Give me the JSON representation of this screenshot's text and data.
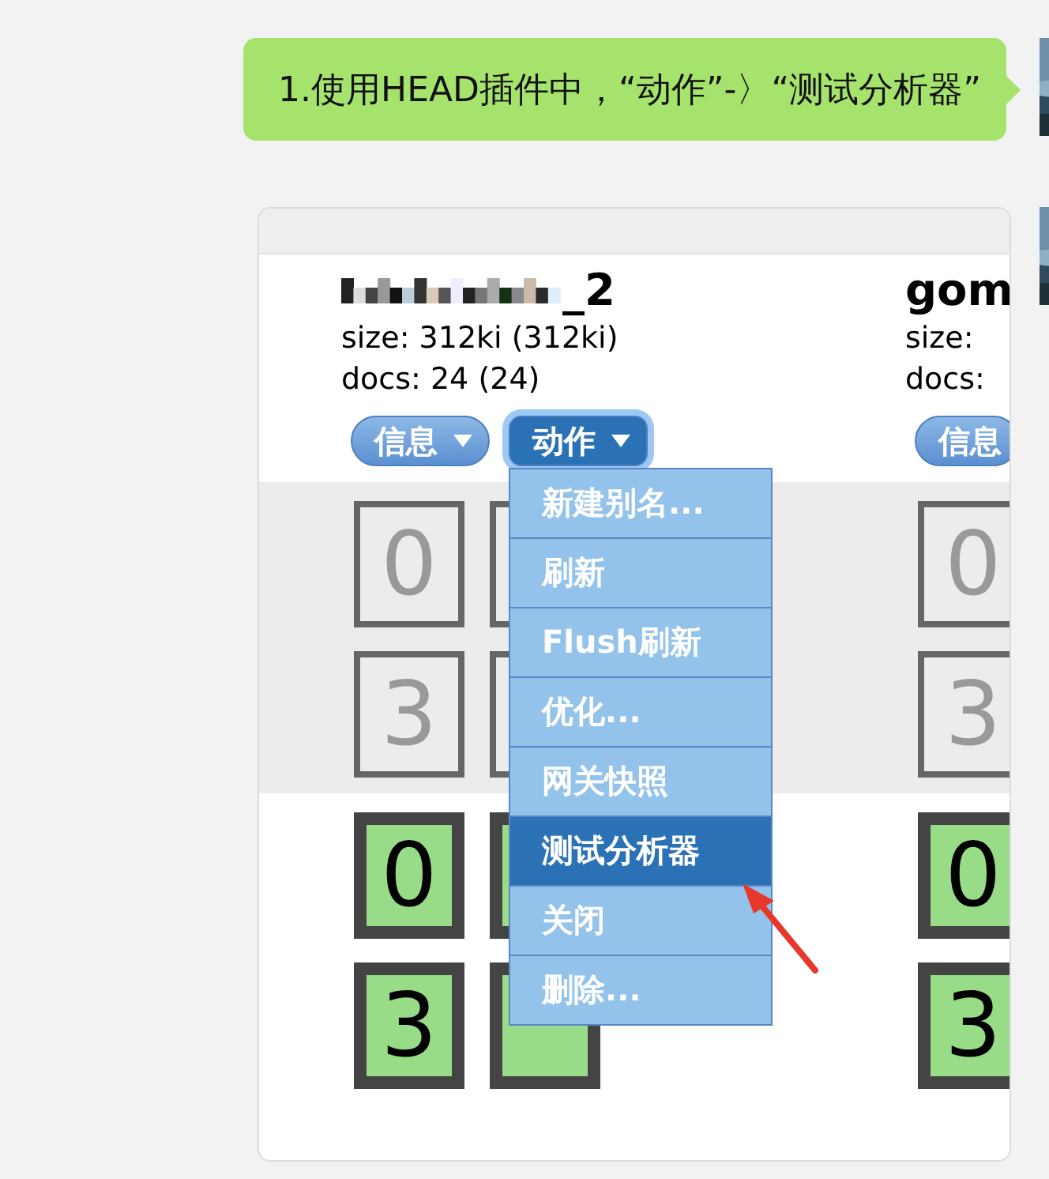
{
  "messages": [
    {
      "kind": "text",
      "text": "1.使用HEAD插件中，“动作”-〉“测试分析器”"
    },
    {
      "kind": "screenshot",
      "indices": [
        {
          "name": "_2",
          "redacted": true,
          "size": "size: 312ki (312ki)",
          "docs": "docs: 24 (24)",
          "buttons": [
            {
              "label": "信息",
              "active": false
            },
            {
              "label": "动作",
              "active": true
            }
          ],
          "shard_rows": [
            {
              "kind": "unassigned",
              "shards": [
                {
                  "label": "0"
                },
                {
                  "covered": true
                }
              ]
            },
            {
              "kind": "unassigned",
              "shards": [
                {
                  "label": "3"
                },
                {
                  "covered": true
                }
              ]
            },
            {
              "kind": "primary",
              "shards": [
                {
                  "label": "0"
                },
                {
                  "covered": true
                }
              ]
            },
            {
              "kind": "primary",
              "shards": [
                {
                  "label": "3"
                },
                {
                  "covered": true
                }
              ]
            }
          ]
        },
        {
          "name": "gom",
          "redacted": false,
          "size": "size: ",
          "docs": "docs: ",
          "buttons": [
            {
              "label": "信息",
              "active": false
            }
          ],
          "shard_rows": [
            {
              "kind": "unassigned",
              "shards": [
                {
                  "label": "0"
                }
              ]
            },
            {
              "kind": "unassigned",
              "shards": [
                {
                  "label": "3"
                }
              ]
            },
            {
              "kind": "primary",
              "shards": [
                {
                  "label": "0"
                }
              ]
            },
            {
              "kind": "primary",
              "shards": [
                {
                  "label": "3"
                }
              ]
            }
          ]
        }
      ],
      "menu": [
        {
          "label": "新建别名...",
          "selected": false
        },
        {
          "label": "刷新",
          "selected": false
        },
        {
          "label": "Flush刷新",
          "selected": false
        },
        {
          "label": "优化...",
          "selected": false
        },
        {
          "label": "网关快照",
          "selected": false
        },
        {
          "label": "测试分析器",
          "selected": true
        },
        {
          "label": "关闭",
          "selected": false
        },
        {
          "label": "删除...",
          "selected": false
        }
      ]
    }
  ]
}
